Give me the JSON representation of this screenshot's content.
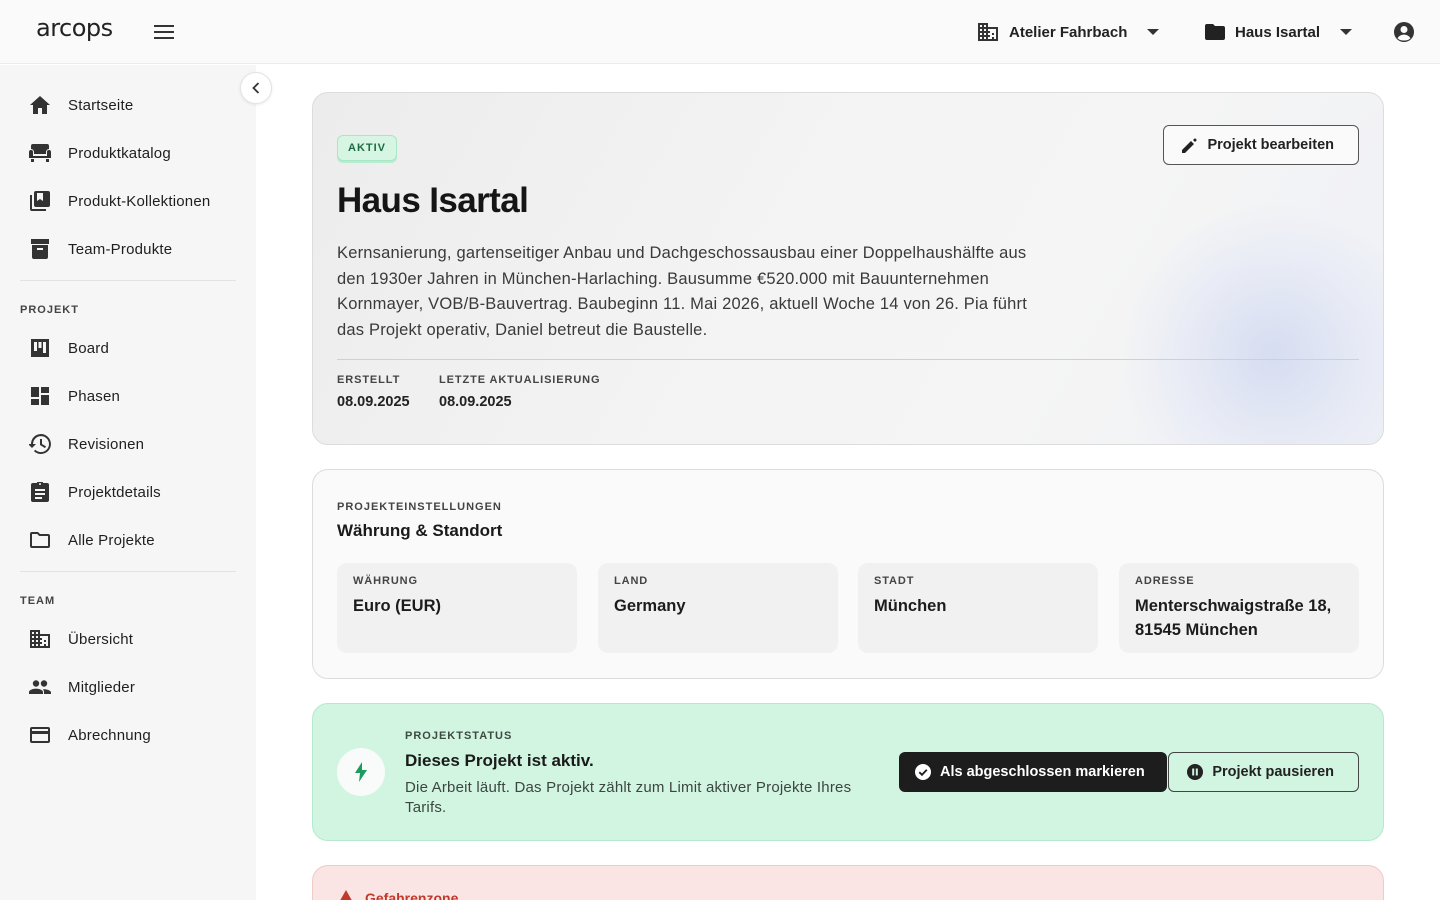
{
  "app": {
    "logo": "arcops"
  },
  "topbar": {
    "org_selector": "Atelier Fahrbach",
    "project_selector": "Haus Isartal"
  },
  "sidebar": {
    "items": [
      {
        "label": "Startseite",
        "icon": "home-icon"
      },
      {
        "label": "Produktkatalog",
        "icon": "sofa-icon"
      },
      {
        "label": "Produkt-Kollektionen",
        "icon": "library-icon"
      },
      {
        "label": "Team-Produkte",
        "icon": "archive-icon"
      }
    ],
    "project_section": "PROJEKT",
    "project_items": [
      {
        "label": "Board",
        "icon": "board-icon"
      },
      {
        "label": "Phasen",
        "icon": "dashboard-icon"
      },
      {
        "label": "Revisionen",
        "icon": "history-icon"
      },
      {
        "label": "Projektdetails",
        "icon": "clipboard-icon"
      },
      {
        "label": "Alle Projekte",
        "icon": "folder-icon"
      }
    ],
    "team_section": "TEAM",
    "team_items": [
      {
        "label": "Übersicht",
        "icon": "building-icon"
      },
      {
        "label": "Mitglieder",
        "icon": "people-icon"
      },
      {
        "label": "Abrechnung",
        "icon": "credit-card-icon"
      }
    ]
  },
  "hero": {
    "badge": "AKTIV",
    "edit_label": "Projekt bearbeiten",
    "title": "Haus Isartal",
    "description": "Kernsanierung, gartenseitiger Anbau und Dachgeschossausbau einer Doppelhaushälfte aus den 1930er Jahren in München-Harlaching. Bausumme €520.000 mit Bauunternehmen Kornmayer, VOB/B-Bauvertrag. Baubeginn 11. Mai 2026, aktuell Woche 14 von 26. Pia führt das Projekt operativ, Daniel betreut die Baustelle.",
    "created_label": "ERSTELLT",
    "created_value": "08.09.2025",
    "updated_label": "LETZTE AKTUALISIERUNG",
    "updated_value": "08.09.2025"
  },
  "settings": {
    "kicker": "PROJEKTEINSTELLUNGEN",
    "title": "Währung & Standort",
    "fields": [
      {
        "label": "WÄHRUNG",
        "value": "Euro (EUR)"
      },
      {
        "label": "LAND",
        "value": "Germany"
      },
      {
        "label": "STADT",
        "value": "München"
      },
      {
        "label": "ADRESSE",
        "value": "Menterschwaigstraße 18, 81545 München"
      }
    ]
  },
  "status": {
    "kicker": "PROJEKTSTATUS",
    "title": "Dieses Projekt ist aktiv.",
    "description": "Die Arbeit läuft. Das Projekt zählt zum Limit aktiver Projekte Ihres Tarifs.",
    "complete_label": "Als abgeschlossen markieren",
    "pause_label": "Projekt pausieren"
  },
  "danger": {
    "title": "Gefahrenzone"
  },
  "colors": {
    "accent_green": "#1d9a5e",
    "badge_bg": "#d6f5e3",
    "status_bg": "#d2f5e2",
    "danger_bg": "#fbe4e4",
    "danger_text": "#c0392b"
  }
}
